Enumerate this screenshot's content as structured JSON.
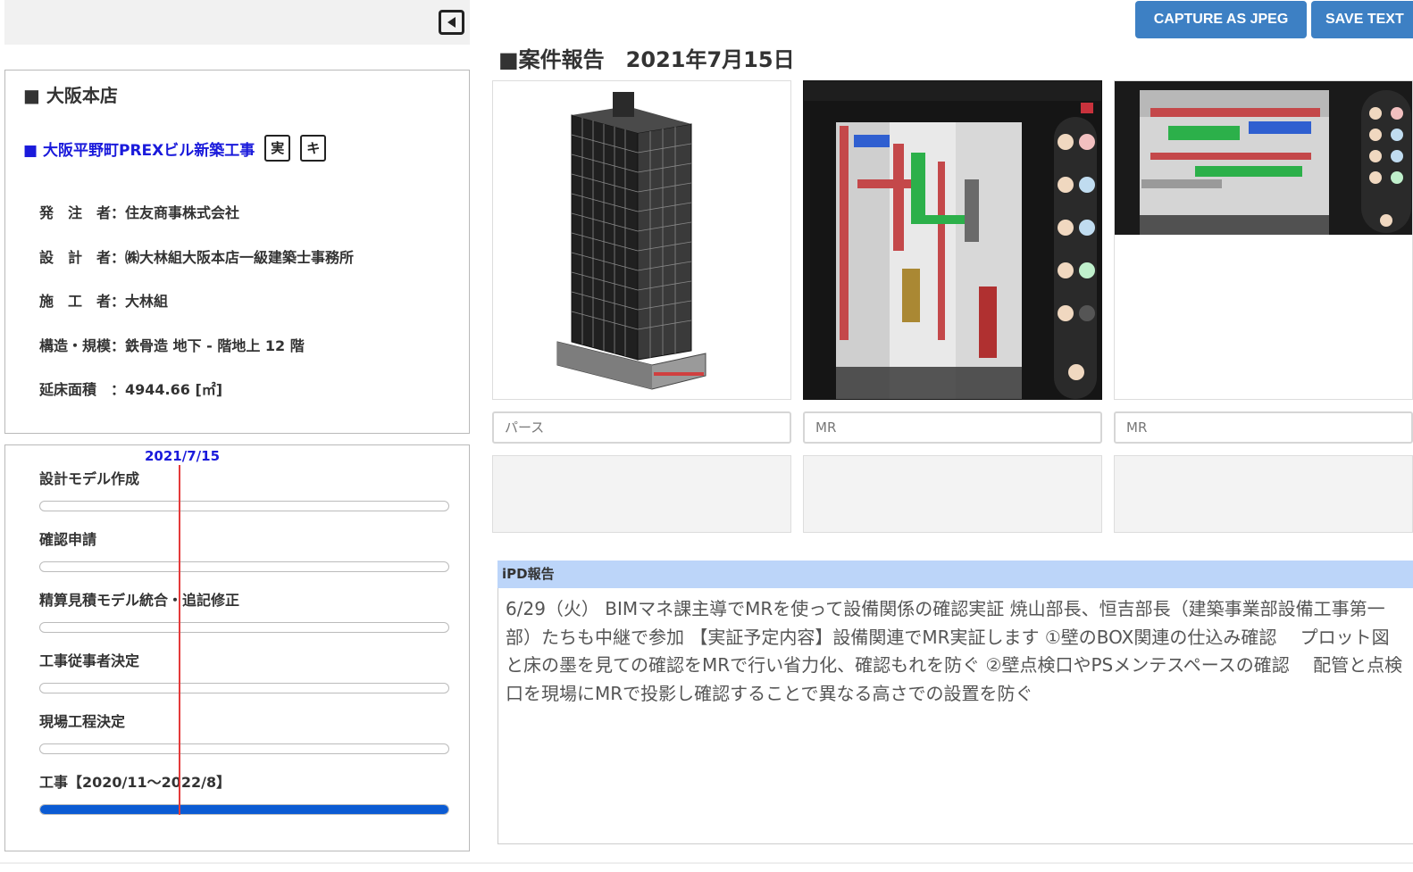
{
  "left_panel": {
    "collapse_icon": "collapse-left-icon",
    "branch_title": "■ 大阪本店",
    "project_title": "■ 大阪平野町PREXビル新築工事",
    "tags": [
      "実",
      "キ"
    ],
    "info": [
      "発　注　者：住友商事株式会社",
      "設　計　者：㈱大林組大阪本店一級建築士事務所",
      "施　工　者：大林組",
      "構造・規模：鉄骨造 地下 - 階地上 12 階",
      "延床面積　：4944.66 [㎡]"
    ]
  },
  "schedule": {
    "date_marker": "2021/7/15",
    "tasks": [
      {
        "label": "設計モデル作成",
        "progress": 0
      },
      {
        "label": "確認申請",
        "progress": 0
      },
      {
        "label": "精算見積モデル統合・追記修正",
        "progress": 0
      },
      {
        "label": "工事従事者決定",
        "progress": 0
      },
      {
        "label": "現場工程決定",
        "progress": 0
      },
      {
        "label": "工事【2020/11～2022/8】",
        "progress": 100
      }
    ],
    "colors": {
      "marker": "#e43b3b",
      "fill": "#0b5bd3"
    }
  },
  "toolbar": {
    "capture_label": "CAPTURE AS JPEG",
    "save_label": "SAVE TEXT"
  },
  "report": {
    "title": "■案件報告　2021年7月15日",
    "images": [
      {
        "caption_placeholder": "パース",
        "icon": "building-perspective-image"
      },
      {
        "caption_placeholder": "MR",
        "icon": "mr-screenshot-image"
      },
      {
        "caption_placeholder": "MR",
        "icon": "mr-screenshot-image"
      }
    ],
    "ipd_header": "iPD報告",
    "ipd_text": "6/29（火） BIMマネ課主導でMRを使って設備関係の確認実証 焼山部長、恒吉部長（建築事業部設備工事第一部）たちも中継で参加 【実証予定内容】設備関連でMR実証します ①壁のBOX関連の仕込み確認　 プロット図と床の墨を見ての確認をMRで行い省力化、確認もれを防ぐ ②壁点検口やPSメンテスペースの確認　 配管と点検口を現場にMRで投影し確認することで異なる高さでの設置を防ぐ"
  }
}
